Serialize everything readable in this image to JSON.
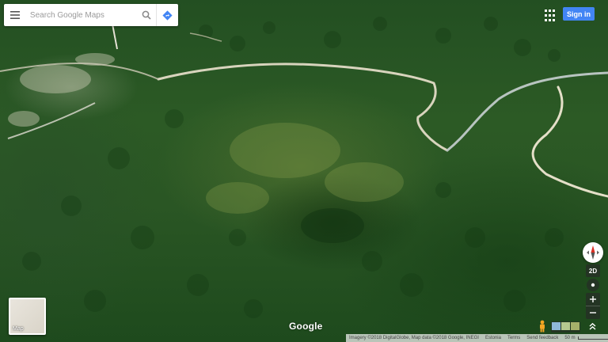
{
  "search": {
    "placeholder": "Search Google Maps"
  },
  "header": {
    "signin_label": "Sign in"
  },
  "controls": {
    "tilt_label": "2D"
  },
  "minimap": {
    "label": "Map"
  },
  "logo": {
    "text": "Google"
  },
  "footer": {
    "attribution": "Imagery ©2018 DigitalGlobe, Map data ©2018 Google, INEGI",
    "country": "Estonia",
    "terms": "Terms",
    "feedback": "Send feedback",
    "scale_label": "50 m"
  },
  "icons": {
    "menu": "menu-icon",
    "search": "search-icon",
    "directions": "directions-icon",
    "apps": "apps-grid-icon",
    "compass": "compass-icon",
    "pegman": "pegman-icon",
    "expand": "chevron-up-icon"
  },
  "colors": {
    "accent": "#4285f4",
    "directions": "#4285f4",
    "compass_north": "#d93025"
  }
}
